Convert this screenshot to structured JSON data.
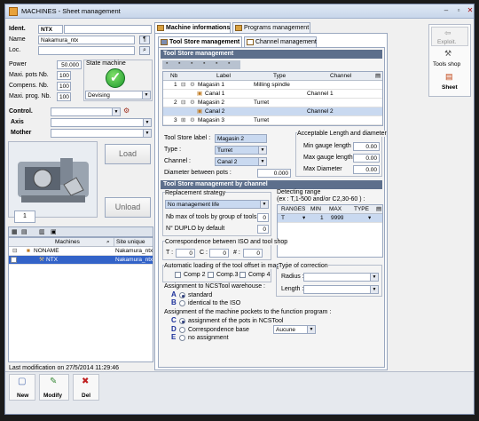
{
  "window": {
    "title": "MACHINES - Sheet management"
  },
  "left": {
    "ident_label": "Ident.",
    "ident_value": "NTX",
    "name_label": "Name",
    "name_value": "Nakamura_ntx",
    "loc_label": "Loc.",
    "power_label": "Power",
    "power_value": "50.000",
    "maxi_pots_label": "Maxi. pots Nb.",
    "maxi_pots_value": "100",
    "compens_label": "Compens. Nb.",
    "compens_value": "100",
    "maxi_prog_label": "Maxi. prog. Nb.",
    "maxi_prog_value": "100",
    "state_machine_label": "State machine",
    "state_value": "Devising",
    "control_label": "Control.",
    "axis_label": "Axis",
    "mother_label": "Mother",
    "load_button": "Load",
    "unload_button": "Unload",
    "thumb_index": "1"
  },
  "machines_list": {
    "col_machines": "Machines",
    "col_site": "Site unique",
    "rows": [
      {
        "name": "NONAME",
        "site": "Nakamura_ntx"
      },
      {
        "name": "NTX",
        "site": "Nakamura_ntx"
      }
    ],
    "last_modification": "Last modification on 27/5/2014 11:29:46"
  },
  "tabs": {
    "top": [
      "Machine informations",
      "Programs management"
    ],
    "sub": [
      "Tool Store management",
      "Channel management"
    ]
  },
  "tool_store": {
    "header": "Tool Store management",
    "columns": [
      "Nb",
      "Label",
      "Type",
      "Channel"
    ],
    "rows": [
      {
        "nb": "1",
        "label": "Magasin 1",
        "type": "Milling spindle",
        "channel": ""
      },
      {
        "nb": "",
        "label": "Canal 1",
        "type": "",
        "channel": "Channel 1"
      },
      {
        "nb": "2",
        "label": "Magasin 2",
        "type": "Turret",
        "channel": ""
      },
      {
        "nb": "",
        "label": "Canal 2",
        "type": "",
        "channel": "Channel 2"
      },
      {
        "nb": "3",
        "label": "Magasin 3",
        "type": "Turret",
        "channel": ""
      }
    ],
    "label_label": "Tool Store label :",
    "label_value": "Magasin 2",
    "type_label": "Type :",
    "type_value": "Turret",
    "channel_label": "Channel :",
    "channel_value": "Canal 2",
    "diameter_label": "Diameter between pots :",
    "diameter_value": "0.000",
    "acceptable_title": "Acceptable Length and diameter",
    "min_gauge_label": "Min gauge length :",
    "min_gauge_value": "0.00",
    "max_gauge_label": "Max gauge length :",
    "max_gauge_value": "0.00",
    "max_diameter_label": "Max Diameter",
    "max_diameter_value": "0.00"
  },
  "by_channel": {
    "header": "Tool Store management by channel",
    "replacement_title": "Replacement strategy",
    "replacement_value": "No management life",
    "nb_max_label": "Nb max of tools by group of tools",
    "nb_max_value": "0",
    "duplo_label": "N° DUPLO by default",
    "duplo_value": "0",
    "detecting_title": "Detecting range",
    "detecting_hint": "(ex : T,1-500 and/or C2,30-60 ) :",
    "range_columns": [
      "RANGES",
      "MIN",
      "MAX",
      "TYPE"
    ],
    "range_row": {
      "ranges": "T",
      "min": "1",
      "max": "9999",
      "type": ""
    },
    "correspondence_title": "Correspondence between ISO and tool shop",
    "t_label": "T :",
    "t_value": "0",
    "c_label": "C :",
    "c_value": "0",
    "hash_label": "# :",
    "hash_value": "0",
    "auto_title": "Automatic loading of the tool offset in magazine",
    "comp2": "Comp 2",
    "comp3": "Comp.3",
    "comp4": "Comp 4",
    "type_corr_title": "Type of correction",
    "radius_label": "Radius :",
    "length_label": "Length :",
    "assign_wh_title": "Assignment to NCSTool warehouse :",
    "opt_a_letter": "A",
    "opt_a": "standard",
    "opt_b_letter": "B",
    "opt_b": "identical to the ISO",
    "assign_pockets_title": "Assignment of the machine pockets to the function program :",
    "opt_c_letter": "C",
    "opt_c": "assignment of the pots in NCSTool",
    "opt_d_letter": "D",
    "opt_d": "Correspondence base",
    "opt_d_select": "Aucune",
    "opt_e_letter": "E",
    "opt_e": "no assignment"
  },
  "side_toolbar": {
    "exploit": "Exploit.",
    "tools_shop": "Tools shop",
    "sheet": "Sheet"
  },
  "bottom_toolbar": {
    "new": "New",
    "modify": "Modify",
    "del": "Del"
  }
}
